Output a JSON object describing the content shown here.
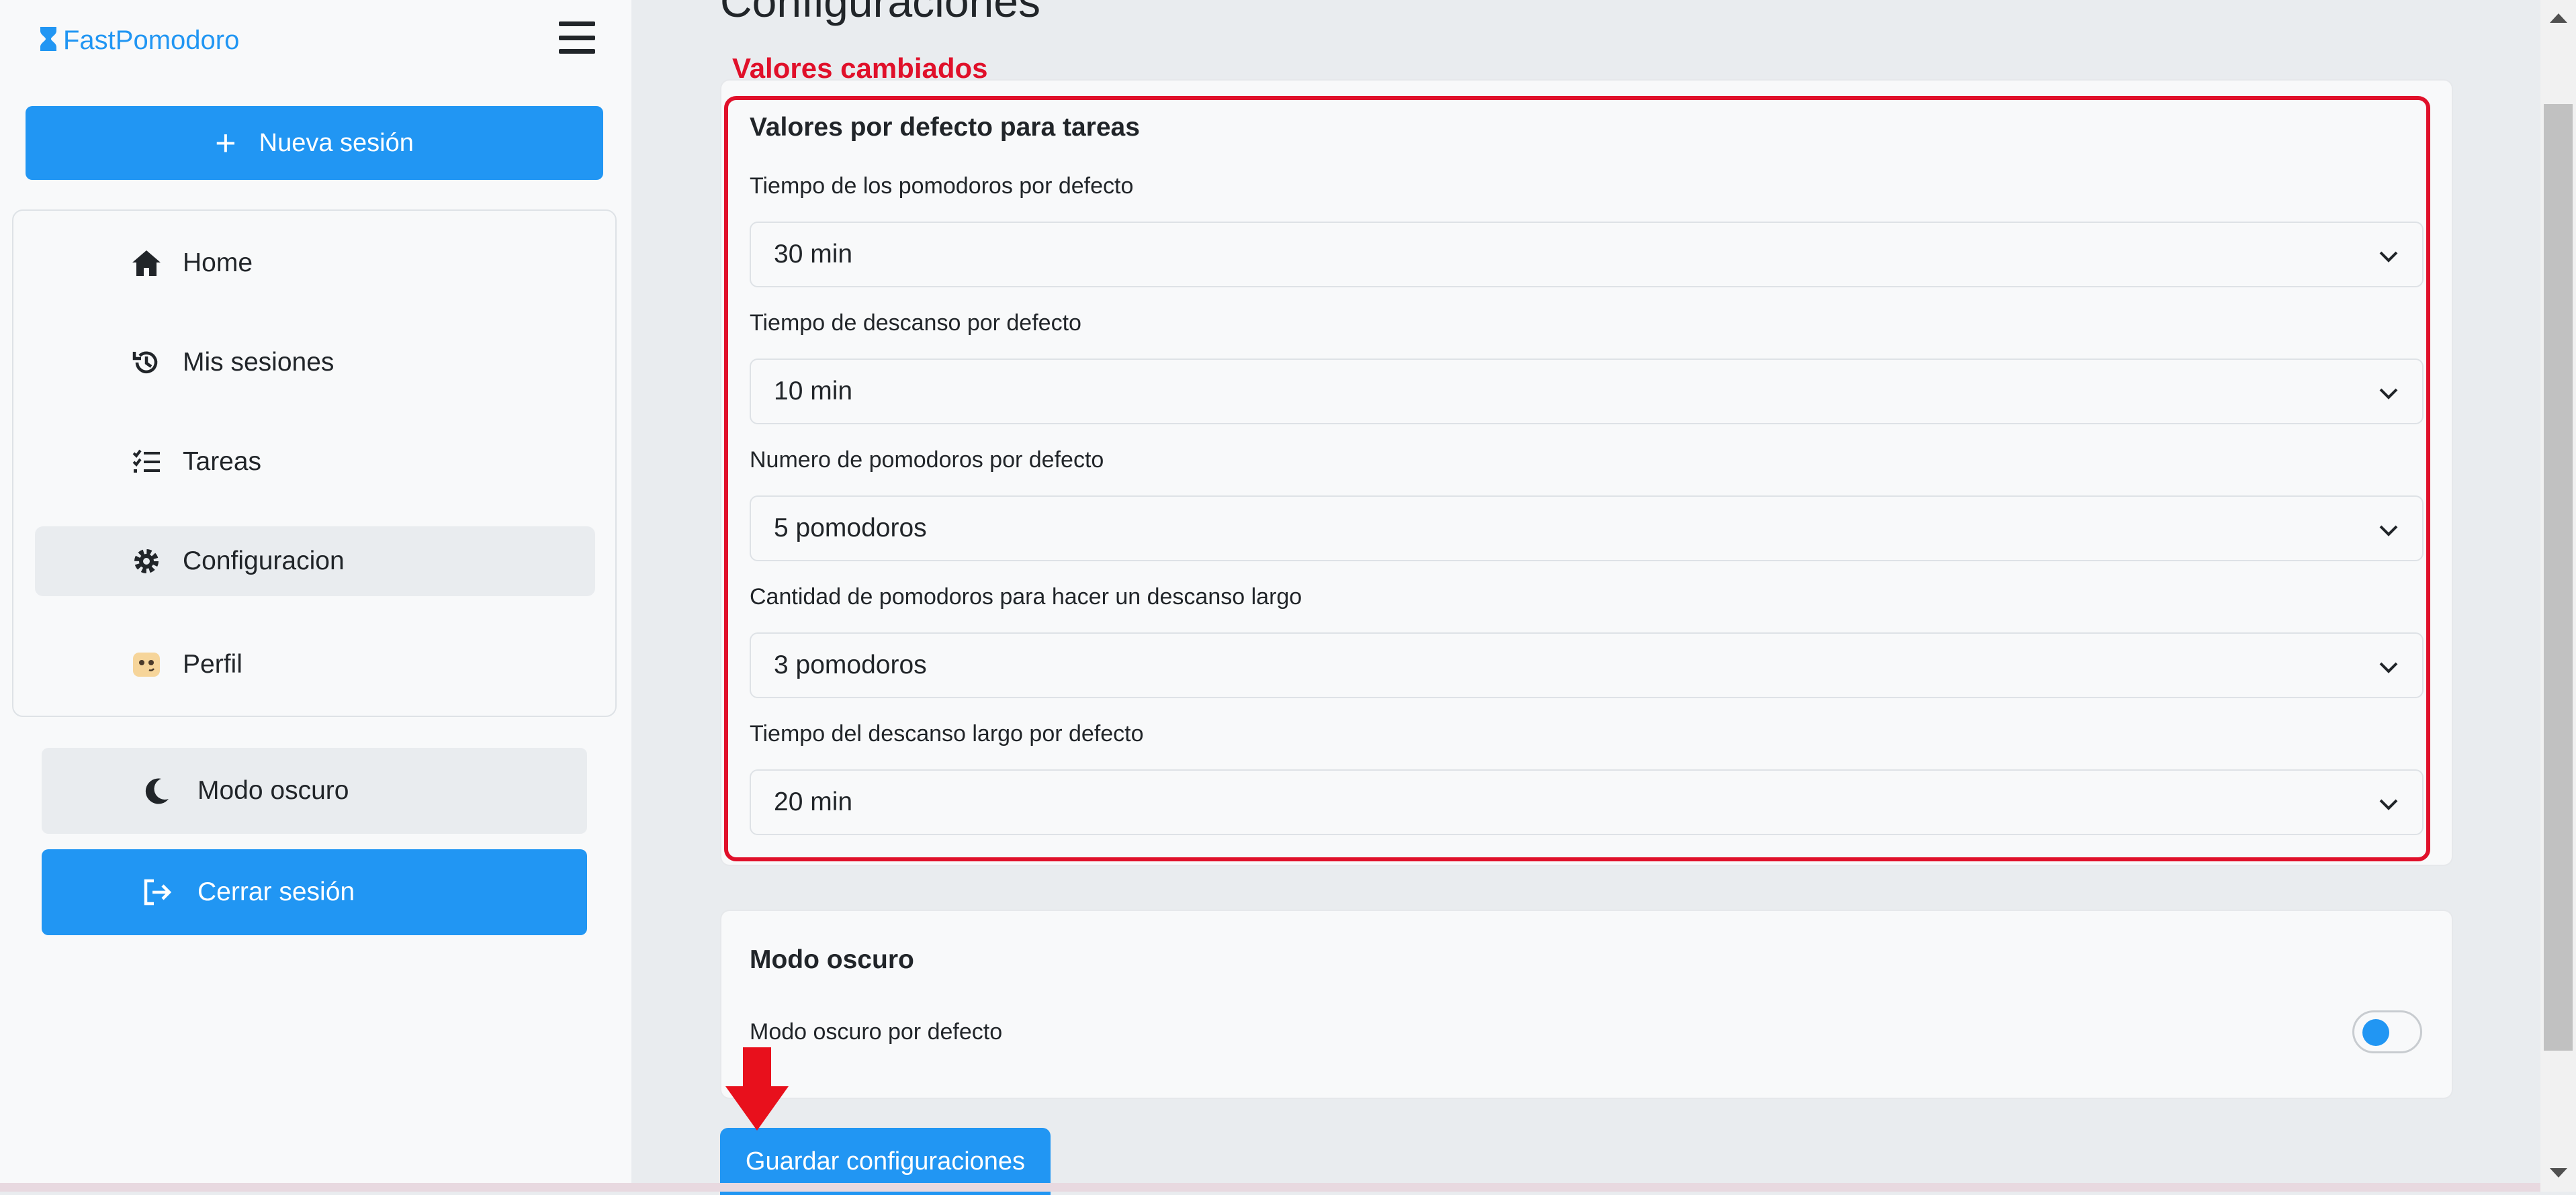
{
  "sidebar": {
    "brand": "FastPomodoro",
    "new_session": "Nueva sesión",
    "items": [
      {
        "label": "Home",
        "icon": "home-icon"
      },
      {
        "label": "Mis sesiones",
        "icon": "history-icon"
      },
      {
        "label": "Tareas",
        "icon": "tasks-icon"
      },
      {
        "label": "Configuracion",
        "icon": "gear-icon",
        "active": true
      },
      {
        "label": "Perfil",
        "icon": "avatar-icon"
      }
    ],
    "dark_mode": "Modo oscuro",
    "logout": "Cerrar sesión"
  },
  "main": {
    "title": "Configuraciones",
    "annotation": "Valores cambiados",
    "tasks_card": {
      "title": "Valores por defecto para tareas",
      "fields": [
        {
          "label": "Tiempo de los pomodoros por defecto",
          "value": "30 min"
        },
        {
          "label": "Tiempo de descanso por defecto",
          "value": "10 min"
        },
        {
          "label": "Numero de pomodoros por defecto",
          "value": "5 pomodoros"
        },
        {
          "label": "Cantidad de pomodoros para hacer un descanso largo",
          "value": "3 pomodoros"
        },
        {
          "label": "Tiempo del descanso largo por defecto",
          "value": "20 min"
        }
      ]
    },
    "dark_card": {
      "title": "Modo oscuro",
      "toggle_label": "Modo oscuro por defecto",
      "toggle_on": false
    },
    "save_button": "Guardar configuraciones"
  },
  "colors": {
    "accent": "#2196f3",
    "annotation": "#e0102a",
    "sidebar_bg": "#f8f9fa",
    "main_bg": "#e9ecef"
  }
}
